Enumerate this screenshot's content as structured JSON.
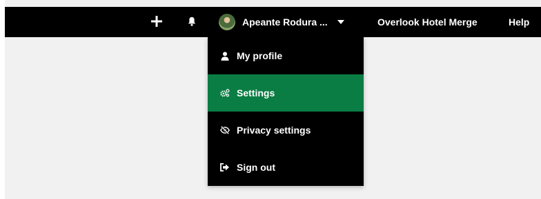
{
  "colors": {
    "topbar_bg": "#000000",
    "menu_bg": "#000000",
    "active_item_bg": "#0a7d44",
    "page_bg": "#f1f1f1",
    "text": "#ffffff"
  },
  "topbar": {
    "add_icon": "plus-icon",
    "notifications_icon": "bell-icon",
    "user": {
      "avatar": "user-avatar",
      "name": "Apeante Rodura ...",
      "caret_icon": "caret-down-icon"
    },
    "hotel_name": "Overlook Hotel Merge",
    "help_label": "Help"
  },
  "user_menu": {
    "items": [
      {
        "label": "My profile",
        "icon": "person-icon"
      },
      {
        "label": "Settings",
        "icon": "gears-icon",
        "active": true
      },
      {
        "label": "Privacy settings",
        "icon": "eye-slash-icon"
      },
      {
        "label": "Sign out",
        "icon": "sign-out-icon"
      }
    ]
  }
}
